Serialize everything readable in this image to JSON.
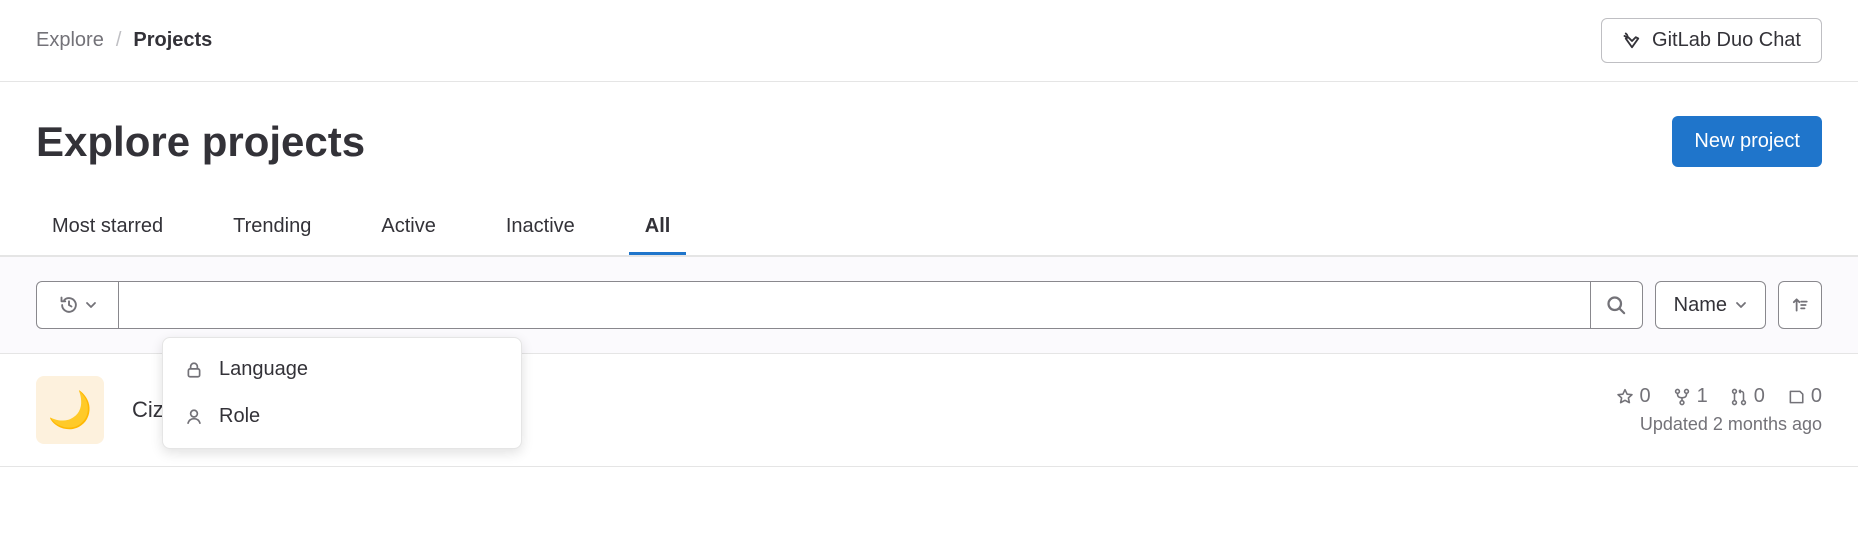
{
  "breadcrumb": {
    "root": "Explore",
    "current": "Projects"
  },
  "header": {
    "duo_chat": "GitLab Duo Chat"
  },
  "title": "Explore projects",
  "actions": {
    "new_project": "New project"
  },
  "tabs": {
    "most_starred": "Most starred",
    "trending": "Trending",
    "active": "Active",
    "inactive": "Inactive",
    "all": "All",
    "active_tab": "all"
  },
  "filter_bar": {
    "sort_label": "Name",
    "dropdown": {
      "language": "Language",
      "role": "Role"
    }
  },
  "project": {
    "emoji": "🌙",
    "name": "Ciz",
    "stars": "0",
    "forks": "1",
    "merge_requests": "0",
    "issues": "0",
    "updated": "Updated 2 months ago"
  }
}
